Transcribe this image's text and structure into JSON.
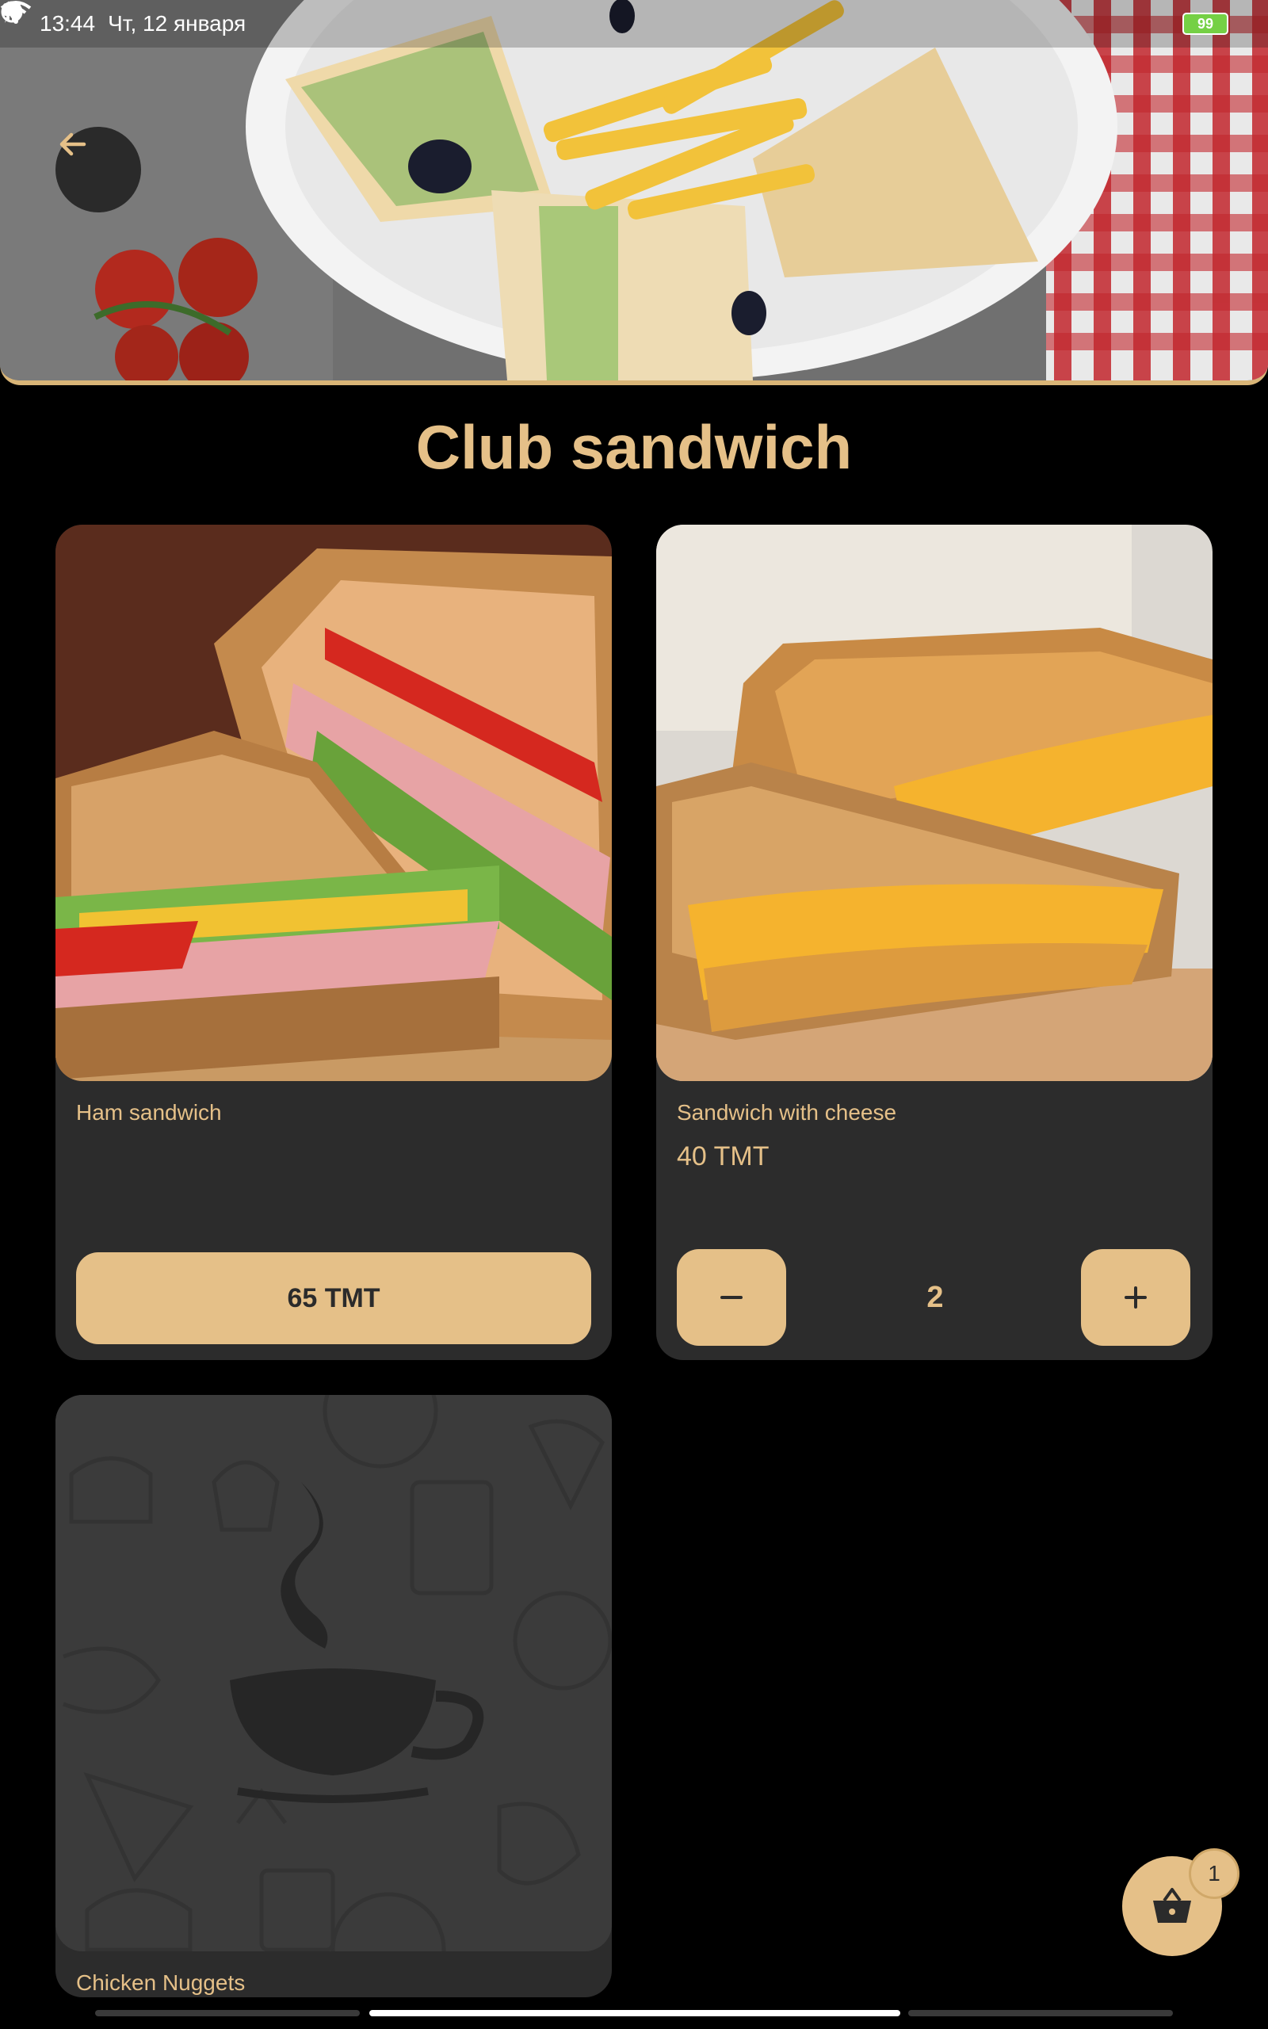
{
  "status": {
    "time": "13:44",
    "date": "Чт, 12 января",
    "battery": "99"
  },
  "page": {
    "title": "Club sandwich"
  },
  "products": [
    {
      "name": "Ham sandwich",
      "price_button": "65 TMT"
    },
    {
      "name": "Sandwich with cheese",
      "price": "40 TMT",
      "quantity": "2"
    },
    {
      "name": "Chicken Nuggets"
    }
  ],
  "cart": {
    "count": "1"
  },
  "icons": {
    "back": "arrow-left-icon",
    "cart": "basket-icon",
    "minus": "minus-icon",
    "plus": "plus-icon"
  },
  "colors": {
    "accent": "#e5c088",
    "card_bg": "#2c2c2c",
    "background": "#000000"
  }
}
